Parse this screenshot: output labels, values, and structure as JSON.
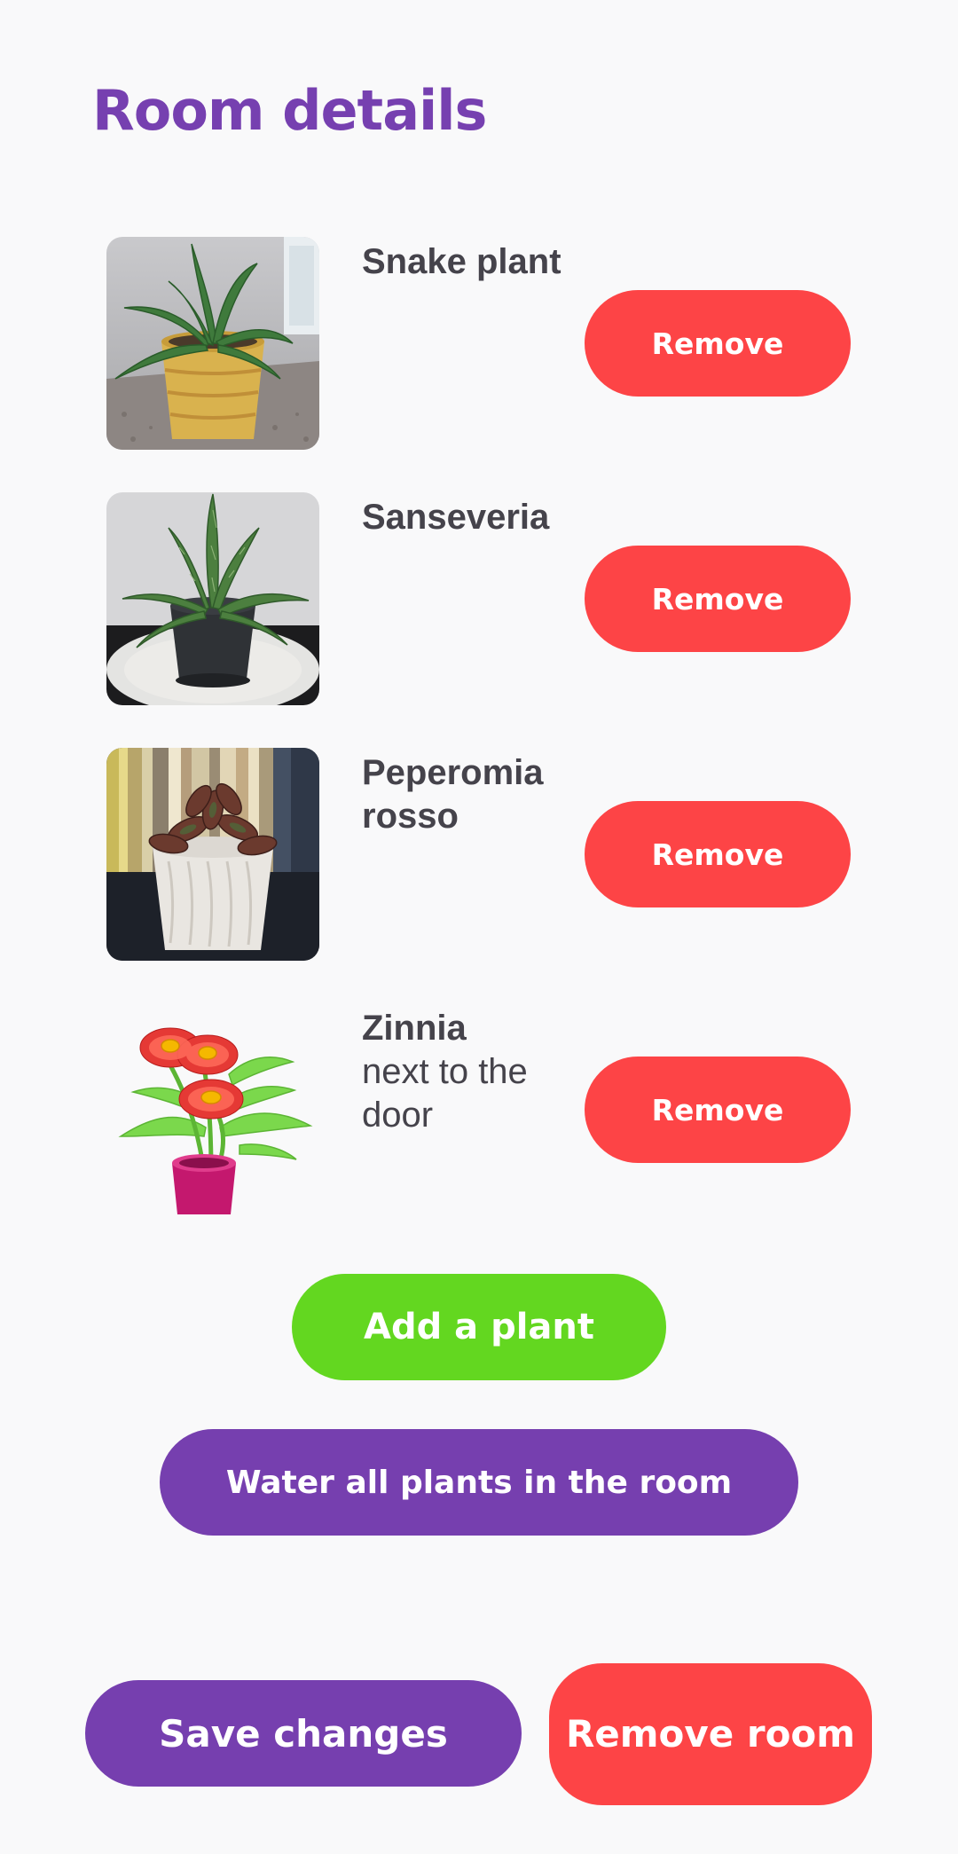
{
  "header": {
    "title": "Room details"
  },
  "plants": [
    {
      "name": "Snake plant",
      "note": "",
      "image_icon": "snake-plant-photo",
      "remove_label": "Remove"
    },
    {
      "name": "Sanseveria",
      "note": "",
      "image_icon": "sanseveria-photo",
      "remove_label": "Remove"
    },
    {
      "name": "Peperomia rosso",
      "note": "",
      "image_icon": "peperomia-photo",
      "remove_label": "Remove"
    },
    {
      "name": "Zinnia",
      "note": "next to the door",
      "image_icon": "zinnia-illustration",
      "remove_label": "Remove"
    }
  ],
  "actions": {
    "add_plant_label": "Add a plant",
    "water_all_label": "Water all plants in the room",
    "save_label": "Save changes",
    "remove_room_label": "Remove room"
  },
  "colors": {
    "background": "#f9f9fa",
    "title": "#7640b0",
    "text": "#45434b",
    "remove_red": "#fd4446",
    "add_green": "#63d720",
    "primary_purple": "#763faf",
    "button_text": "#ffffff"
  }
}
